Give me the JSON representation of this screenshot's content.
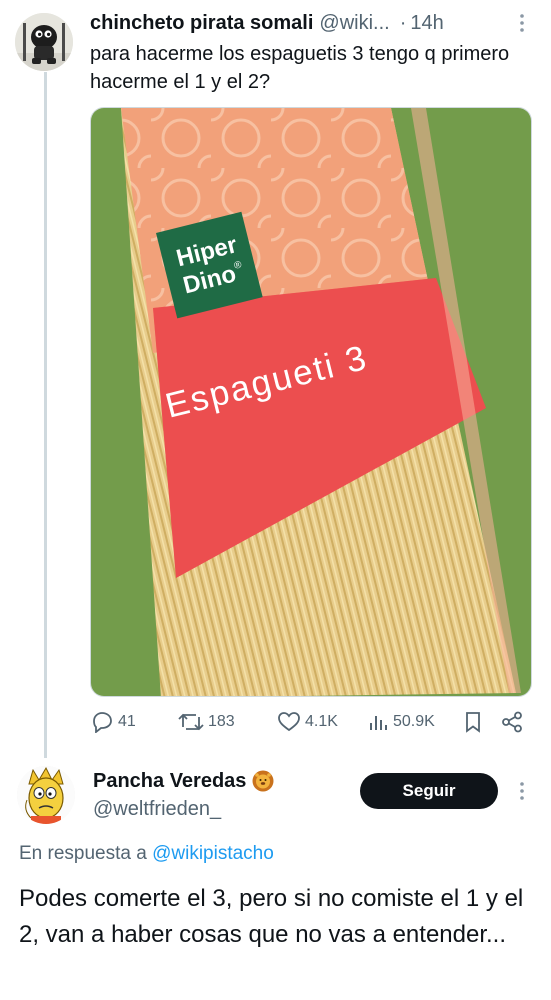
{
  "tweet1": {
    "display_name": "chincheto pirata somali",
    "handle": "@wiki...",
    "separator": "·",
    "time": "14h",
    "text": "para hacerme los espaguetis 3 tengo q primero hacerme el 1 y el 2?",
    "image": {
      "brand_line1": "Hiper",
      "brand_line2": "Dino",
      "brand_mark": "®",
      "product_label": "Espagueti 3"
    },
    "actions": {
      "replies": "41",
      "reposts": "183",
      "likes": "4.1K",
      "views": "50.9K"
    }
  },
  "tweet2": {
    "display_name": "Pancha Veredas",
    "emoji_icon": "lion-face-emoji",
    "handle": "@weltfrieden_",
    "follow_label": "Seguir",
    "reply_prefix": "En respuesta a",
    "reply_handle": "@wikipistacho",
    "text": "Podes comerte el 3, pero si no comiste el 1 y el 2, van a haber cosas que no vas a entender..."
  },
  "colors": {
    "text_primary": "#0f1419",
    "text_secondary": "#536471",
    "link": "#1d9bf0",
    "follow_button_bg": "#0f1419",
    "thread_line": "#cfd9de"
  }
}
